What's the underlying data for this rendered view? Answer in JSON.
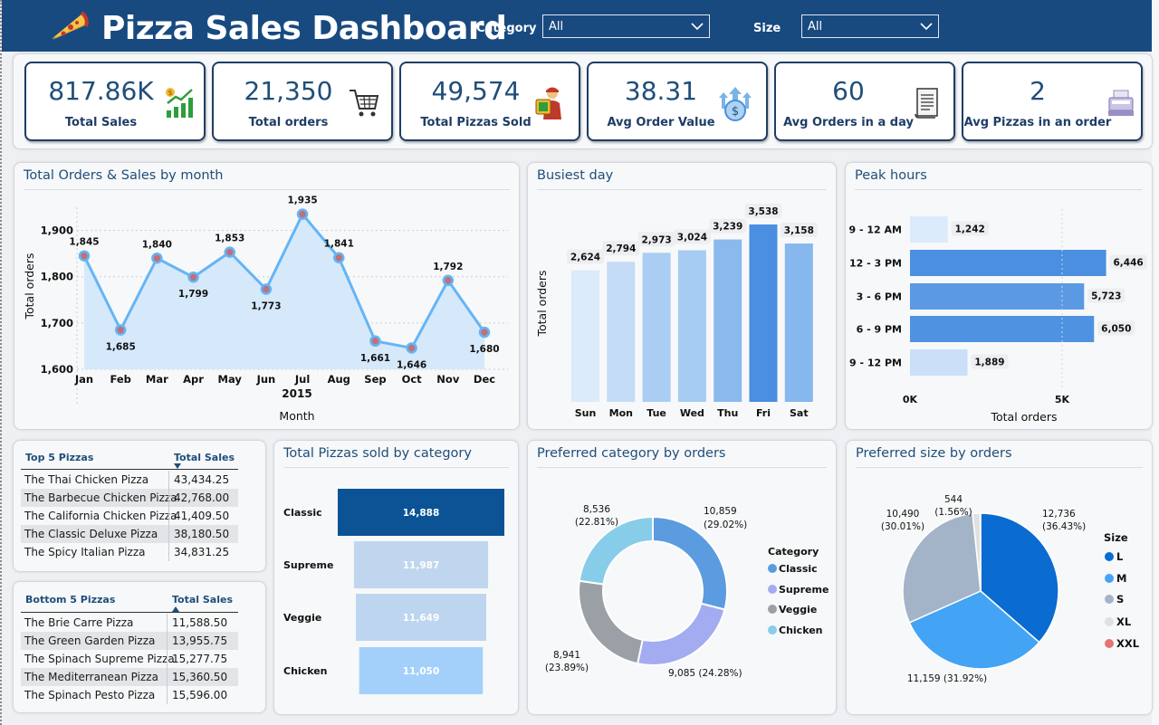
{
  "header": {
    "title": "Pizza Sales Dashboard",
    "category_label": "Category",
    "category_value": "All",
    "size_label": "Size",
    "size_value": "All"
  },
  "kpis": [
    {
      "value": "817.86K",
      "label": "Total Sales",
      "icon": "growth-chart-icon"
    },
    {
      "value": "21,350",
      "label": "Total orders",
      "icon": "shopping-cart-icon"
    },
    {
      "value": "49,574",
      "label": "Total Pizzas Sold",
      "icon": "delivery-person-icon"
    },
    {
      "value": "38.31",
      "label": "Avg Order Value",
      "icon": "money-growth-icon"
    },
    {
      "value": "60",
      "label": "Avg Orders in a day",
      "icon": "document-icon"
    },
    {
      "value": "2",
      "label": "Avg Pizzas in an order",
      "icon": "cash-register-icon"
    }
  ],
  "colors": {
    "header": "#184a80",
    "accent": "#64b5f6",
    "dark_blue": "#0b5394"
  },
  "monthly": {
    "title": "Total Orders & Sales by month",
    "chart_data": {
      "type": "area",
      "categories": [
        "Jan",
        "Feb",
        "Mar",
        "Apr",
        "May",
        "Jun",
        "Jul",
        "Aug",
        "Sep",
        "Oct",
        "Nov",
        "Dec"
      ],
      "values": [
        1845,
        1685,
        1840,
        1799,
        1853,
        1773,
        1935,
        1841,
        1661,
        1646,
        1792,
        1680
      ],
      "value_labels": [
        "1,845",
        "1,685",
        "1,840",
        "1,799",
        "1,853",
        "1,773",
        "1,935",
        "1,841",
        "1,661",
        "1,646",
        "1,792",
        "1,680"
      ],
      "yticks": [
        "1,600",
        "1,700",
        "1,800",
        "1,900"
      ],
      "ylim": [
        1600,
        1950
      ],
      "xlabel": "Month",
      "xsub": "2015",
      "ylabel": "Total orders"
    }
  },
  "busiest": {
    "title": "Busiest day",
    "chart_data": {
      "type": "bar",
      "categories": [
        "Sun",
        "Mon",
        "Tue",
        "Wed",
        "Thu",
        "Fri",
        "Sat"
      ],
      "values": [
        2624,
        2794,
        2973,
        3024,
        3239,
        3538,
        3158
      ],
      "value_labels": [
        "2,624",
        "2,794",
        "2,973",
        "3,024",
        "3,239",
        "3,538",
        "3,158"
      ],
      "colors": [
        "#dcebfb",
        "#c4dcf6",
        "#a9cdf3",
        "#a7ccf3",
        "#8ab9ee",
        "#4a8fe0",
        "#86b8ee"
      ],
      "ylabel": "Total orders"
    }
  },
  "peak": {
    "title": "Peak hours",
    "chart_data": {
      "type": "bar",
      "orientation": "horizontal",
      "categories": [
        "9 - 12 AM",
        "12 - 3 PM",
        "3 - 6 PM",
        "6 - 9 PM",
        "9 - 12 PM"
      ],
      "values": [
        1242,
        6446,
        5723,
        6050,
        1889
      ],
      "value_labels": [
        "1,242",
        "6,446",
        "5,723",
        "6,050",
        "1,889"
      ],
      "colors": [
        "#dcebfb",
        "#4a8fe0",
        "#5b9ae3",
        "#4e92e1",
        "#c9e0f8"
      ],
      "xticks": [
        "0K",
        "5K"
      ],
      "xlabel": "Total orders"
    }
  },
  "top5": {
    "col1": "Top 5 Pizzas",
    "col2": "Total Sales",
    "rows": [
      {
        "name": "The Thai Chicken Pizza",
        "value": "43,434.25"
      },
      {
        "name": "The Barbecue Chicken Pizza",
        "value": "42,768.00"
      },
      {
        "name": "The California Chicken Pizza",
        "value": "41,409.50"
      },
      {
        "name": "The Classic Deluxe Pizza",
        "value": "38,180.50"
      },
      {
        "name": "The Spicy Italian Pizza",
        "value": "34,831.25"
      }
    ]
  },
  "bottom5": {
    "col1": "Bottom 5 Pizzas",
    "col2": "Total Sales",
    "rows": [
      {
        "name": "The Brie Carre Pizza",
        "value": "11,588.50"
      },
      {
        "name": "The Green Garden Pizza",
        "value": "13,955.75"
      },
      {
        "name": "The Spinach Supreme Pizza",
        "value": "15,277.75"
      },
      {
        "name": "The Mediterranean Pizza",
        "value": "15,360.50"
      },
      {
        "name": "The Spinach Pesto Pizza",
        "value": "15,596.00"
      }
    ]
  },
  "category_funnel": {
    "title": "Total Pizzas sold by category",
    "chart_data": {
      "type": "bar",
      "orientation": "funnel",
      "categories": [
        "Classic",
        "Supreme",
        "Veggie",
        "Chicken"
      ],
      "values": [
        14888,
        11987,
        11649,
        11050
      ],
      "value_labels": [
        "14,888",
        "11,987",
        "11,649",
        "11,050"
      ],
      "colors": [
        "#0b5394",
        "#bfd6ee",
        "#bdd5ee",
        "#a3d0fb"
      ]
    }
  },
  "category_donut": {
    "title": "Preferred category by orders",
    "legend_title": "Category",
    "chart_data": {
      "type": "pie",
      "style": "donut",
      "categories": [
        "Classic",
        "Supreme",
        "Veggie",
        "Chicken"
      ],
      "values": [
        10859,
        9085,
        8941,
        8536
      ],
      "percents": [
        "29.02%",
        "24.28%",
        "23.89%",
        "22.81%"
      ],
      "value_labels": [
        "10,859",
        "9,085",
        "8,941",
        "8,536"
      ],
      "colors": [
        "#5b9be0",
        "#a3acf0",
        "#9aa0a6",
        "#87cde9"
      ]
    }
  },
  "size_pie": {
    "title": "Preferred size by orders",
    "legend_title": "Size",
    "chart_data": {
      "type": "pie",
      "categories": [
        "L",
        "M",
        "S",
        "XL",
        "XXL"
      ],
      "values": [
        12736,
        11159,
        10490,
        544,
        28
      ],
      "percents": [
        "36.43%",
        "31.92%",
        "30.01%",
        "1.56%",
        ""
      ],
      "value_labels": [
        "12,736",
        "11,159",
        "10,490",
        "544",
        ""
      ],
      "colors": [
        "#0a6bd0",
        "#43a4f5",
        "#a4b4c8",
        "#e0e0e0",
        "#e57373"
      ]
    }
  }
}
